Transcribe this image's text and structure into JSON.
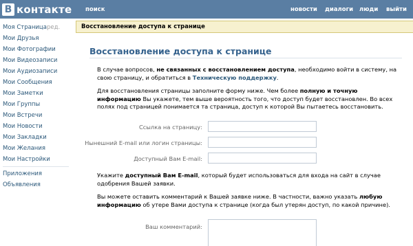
{
  "header": {
    "logo_letter": "В",
    "logo_text": "контакте",
    "search_label": "поиск",
    "nav": [
      "новости",
      "диалоги",
      "люди",
      "выйти"
    ]
  },
  "sidebar": {
    "items": [
      "Моя Страница",
      "Мои Друзья",
      "Мои Фотографии",
      "Мои Видеозаписи",
      "Мои Аудиозаписи",
      "Мои Сообщения",
      "Мои Заметки",
      "Мои Группы",
      "Мои Встречи",
      "Мои Новости",
      "Мои Закладки",
      "Мои Желания",
      "Мои Настройки"
    ],
    "edit_label": "ред.",
    "extra": [
      "Приложения",
      "Объявления"
    ]
  },
  "subbar": {
    "title": "Восстановление доступа к странице"
  },
  "main": {
    "title": "Восстановление доступа к странице",
    "p1_a": "В случае вопросов, ",
    "p1_b": "не связанных с восстановлением доступа",
    "p1_c": ", необходимо войти в систему, на свою страницу, и обратиться в ",
    "p1_link": "Техническую поддержку",
    "p1_d": ".",
    "p2_a": "Для восстановления страницы заполните форму ниже. Чем более ",
    "p2_b": "полную и точную информацию",
    "p2_c": " Вы укажете, тем выше вероятность того, что доступ будет восстановлен. Во всех полях под страницей понимается та страница, доступ к которой Вы пытаетесь восстановить.",
    "fields": [
      {
        "label": "Ссылка на страницу:",
        "value": ""
      },
      {
        "label": "Нынешний E-mail или логин страницы:",
        "value": ""
      },
      {
        "label": "Доступный Вам E-mail:",
        "value": ""
      }
    ],
    "p3_a": "Укажите ",
    "p3_b": "доступный Вам E-mail",
    "p3_c": ", который будет использоваться для входа на сайт в случае одобрения Вашей заявки.",
    "p4_a": "Вы можете оставить комментарий к Вашей заявке ниже. В частности, важно указать ",
    "p4_b": "любую информацию",
    "p4_c": " об утере Вами доступа к странице (когда был утерян доступ, по какой причине).",
    "comment_label": "Ваш комментарий:",
    "comment_value": ""
  }
}
